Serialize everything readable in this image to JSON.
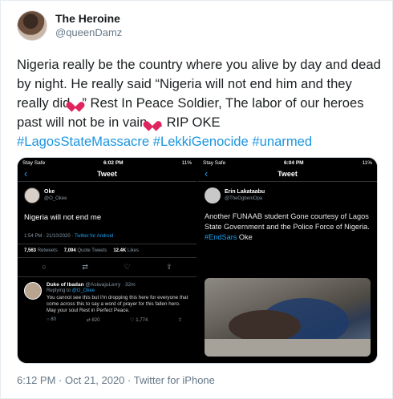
{
  "author": {
    "display_name": "The Heroine",
    "handle": "@queenDamz"
  },
  "tweet": {
    "text_part1": "Nigeria really be the country where you alive by day and dead by night. He really said “Nigeria will not end him and they really did",
    "text_part2": "” Rest In Peace Soldier, The labor of our heroes past will not be in vain",
    "text_part3": ". RIP OKE",
    "hashtags": [
      "#LagosStateMassacre",
      "#LekkiGenocide",
      "#unarmed"
    ],
    "emoji": "broken-heart-icon"
  },
  "screenshot1": {
    "status": {
      "carrier": "Stay Safe",
      "time": "6:02 PM",
      "battery": "11%"
    },
    "nav_title": "Tweet",
    "user": {
      "name": "Oke",
      "handle": "@O_Okee"
    },
    "text": "Nigeria will not end me",
    "meta_time": "1:54 PM · 21/10/2020 · ",
    "meta_via": "Twitter for Android",
    "stats": {
      "retweets": "7,563",
      "retweets_label": "Retweets",
      "quotes": "7,094",
      "quotes_label": "Quote Tweets",
      "likes": "12.4K",
      "likes_label": "Likes"
    },
    "reply": {
      "name": "Duke of Ibadan",
      "handle": "@AsiwajuLerry · 32m",
      "replying_label": "Replying to",
      "replying_handle": "@O_Okee",
      "text": "You cannot see this but I'm dropping this here for everyone that come across this to say a word of prayer for this fallen hero. May your soul Rest in Perfect Peace.",
      "replies": "80",
      "retweets": "820",
      "likes": "1,774"
    }
  },
  "screenshot2": {
    "status": {
      "carrier": "Stay Safe",
      "time": "6:04 PM",
      "battery": "11%"
    },
    "nav_title": "Tweet",
    "user": {
      "name": "Erin Lakataabu",
      "handle": "@TheOgbeniOpa"
    },
    "text": "Another FUNAAB student Gone courtesy of Lagos State Government and the Police Force of Nigeria. ",
    "tag": "#EndSars",
    "tail": " Oke"
  },
  "footer": {
    "time": "6:12 PM · Oct 21, 2020 · ",
    "source": "Twitter for iPhone"
  },
  "colors": {
    "hashtag": "#1b95e0",
    "link": "#1da1f2",
    "muted": "#657786",
    "heart": "#e0245e"
  }
}
